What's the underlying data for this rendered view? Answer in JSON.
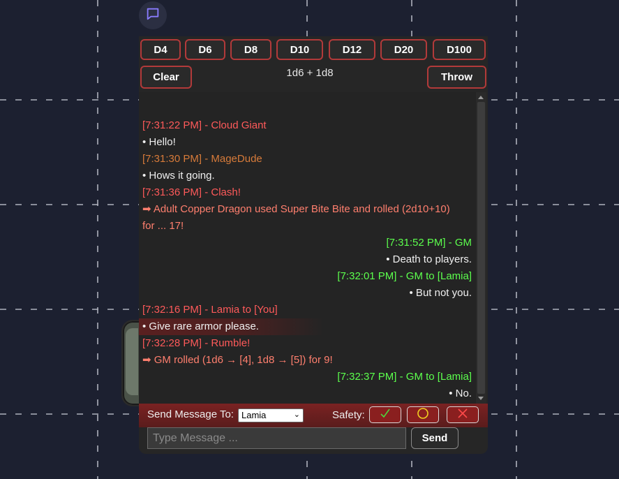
{
  "chat_toggle": {
    "icon": "chat-bubble-icon"
  },
  "dice": [
    {
      "label": "D4"
    },
    {
      "label": "D6"
    },
    {
      "label": "D8"
    },
    {
      "label": "D10"
    },
    {
      "label": "D12"
    },
    {
      "label": "D20"
    },
    {
      "label": "D100"
    }
  ],
  "controls": {
    "clear_label": "Clear",
    "throw_label": "Throw",
    "formula": "1d6 + 1d8"
  },
  "messages": [
    {
      "text": "[7:31:22 PM] - Cloud Giant",
      "color": "#ff5a5a",
      "align": "left"
    },
    {
      "text": "• Hello!",
      "color": "#f0f0f0",
      "align": "left"
    },
    {
      "text": "[7:31:30 PM] - MageDude",
      "color": "#d77b3a",
      "align": "left"
    },
    {
      "text": "• Hows it going.",
      "color": "#f0f0f0",
      "align": "left"
    },
    {
      "text": "[7:31:36 PM] - Clash!",
      "color": "#ff5a5a",
      "align": "left"
    },
    {
      "text": "➡ Adult Copper Dragon used Super Bite Bite and rolled (2d10+10)",
      "color": "#ff7f6e",
      "align": "left"
    },
    {
      "text": "for ... 17!",
      "color": "#ff7f6e",
      "align": "left"
    },
    {
      "text": "[7:31:52 PM] - GM",
      "color": "#5cff4d",
      "align": "right"
    },
    {
      "text": "• Death to players.",
      "color": "#f0f0f0",
      "align": "right"
    },
    {
      "text": "[7:32:01 PM] - GM to [Lamia]",
      "color": "#5cff4d",
      "align": "right"
    },
    {
      "text": "• But not you.",
      "color": "#f0f0f0",
      "align": "right"
    },
    {
      "text": "[7:32:16 PM] - Lamia to [You]",
      "color": "#ff5a5a",
      "align": "left"
    },
    {
      "text": "• Give rare armor please.",
      "color": "#f0f0f0",
      "align": "left",
      "highlight": true
    },
    {
      "text": "[7:32:28 PM] - Rumble!",
      "color": "#ff5a5a",
      "align": "left"
    },
    {
      "text": "➡ GM rolled (1d6 → [4], 1d8 → [5]) for 9!",
      "color": "#ff7f6e",
      "align": "left"
    },
    {
      "text": "[7:32:37 PM] - GM to [Lamia]",
      "color": "#5cff4d",
      "align": "right"
    },
    {
      "text": "• No.",
      "color": "#f0f0f0",
      "align": "right"
    }
  ],
  "send_bar": {
    "send_to_label": "Send Message To:",
    "recipient": "Lamia",
    "safety_label": "Safety:",
    "safety_buttons": [
      {
        "icon": "check-icon",
        "color": "#4cd43c"
      },
      {
        "icon": "circle-icon",
        "color": "#f0d020"
      },
      {
        "icon": "cross-icon",
        "color": "#ff4a4a"
      }
    ]
  },
  "composer": {
    "placeholder": "Type Message ...",
    "value": "",
    "send_label": "Send"
  }
}
